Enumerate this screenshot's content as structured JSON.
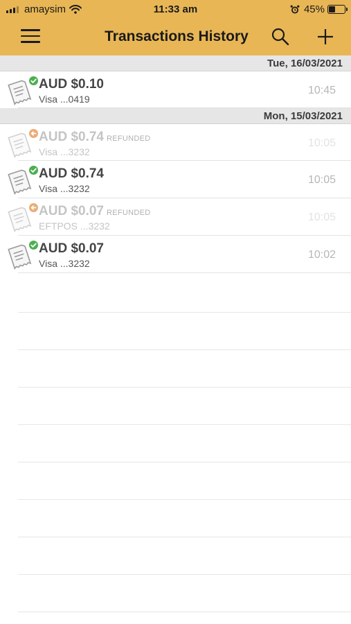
{
  "status_bar": {
    "carrier": "amaysim",
    "time": "11:33 am",
    "battery": "45%",
    "battery_level": 0.45
  },
  "nav": {
    "title": "Transactions History",
    "icons": [
      "menu-icon",
      "search-icon",
      "plus-icon"
    ]
  },
  "colors": {
    "header_bg": "#e8b655",
    "success": "#4caf50",
    "refund": "#e58a3c"
  },
  "sections": [
    {
      "date": "Tue, 16/03/2021",
      "transactions": [
        {
          "amount": "AUD $0.10",
          "tag": "",
          "card": "Visa ...0419",
          "time": "10:45",
          "status": "success"
        }
      ]
    },
    {
      "date": "Mon, 15/03/2021",
      "transactions": [
        {
          "amount": "AUD $0.74",
          "tag": "REFUNDED",
          "card": "Visa ...3232",
          "time": "10:05",
          "status": "refunded"
        },
        {
          "amount": "AUD $0.74",
          "tag": "",
          "card": "Visa ...3232",
          "time": "10:05",
          "status": "success"
        },
        {
          "amount": "AUD $0.07",
          "tag": "REFUNDED",
          "card": "EFTPOS ...3232",
          "time": "10:05",
          "status": "refunded"
        },
        {
          "amount": "AUD $0.07",
          "tag": "",
          "card": "Visa ...3232",
          "time": "10:02",
          "status": "success"
        }
      ]
    }
  ]
}
